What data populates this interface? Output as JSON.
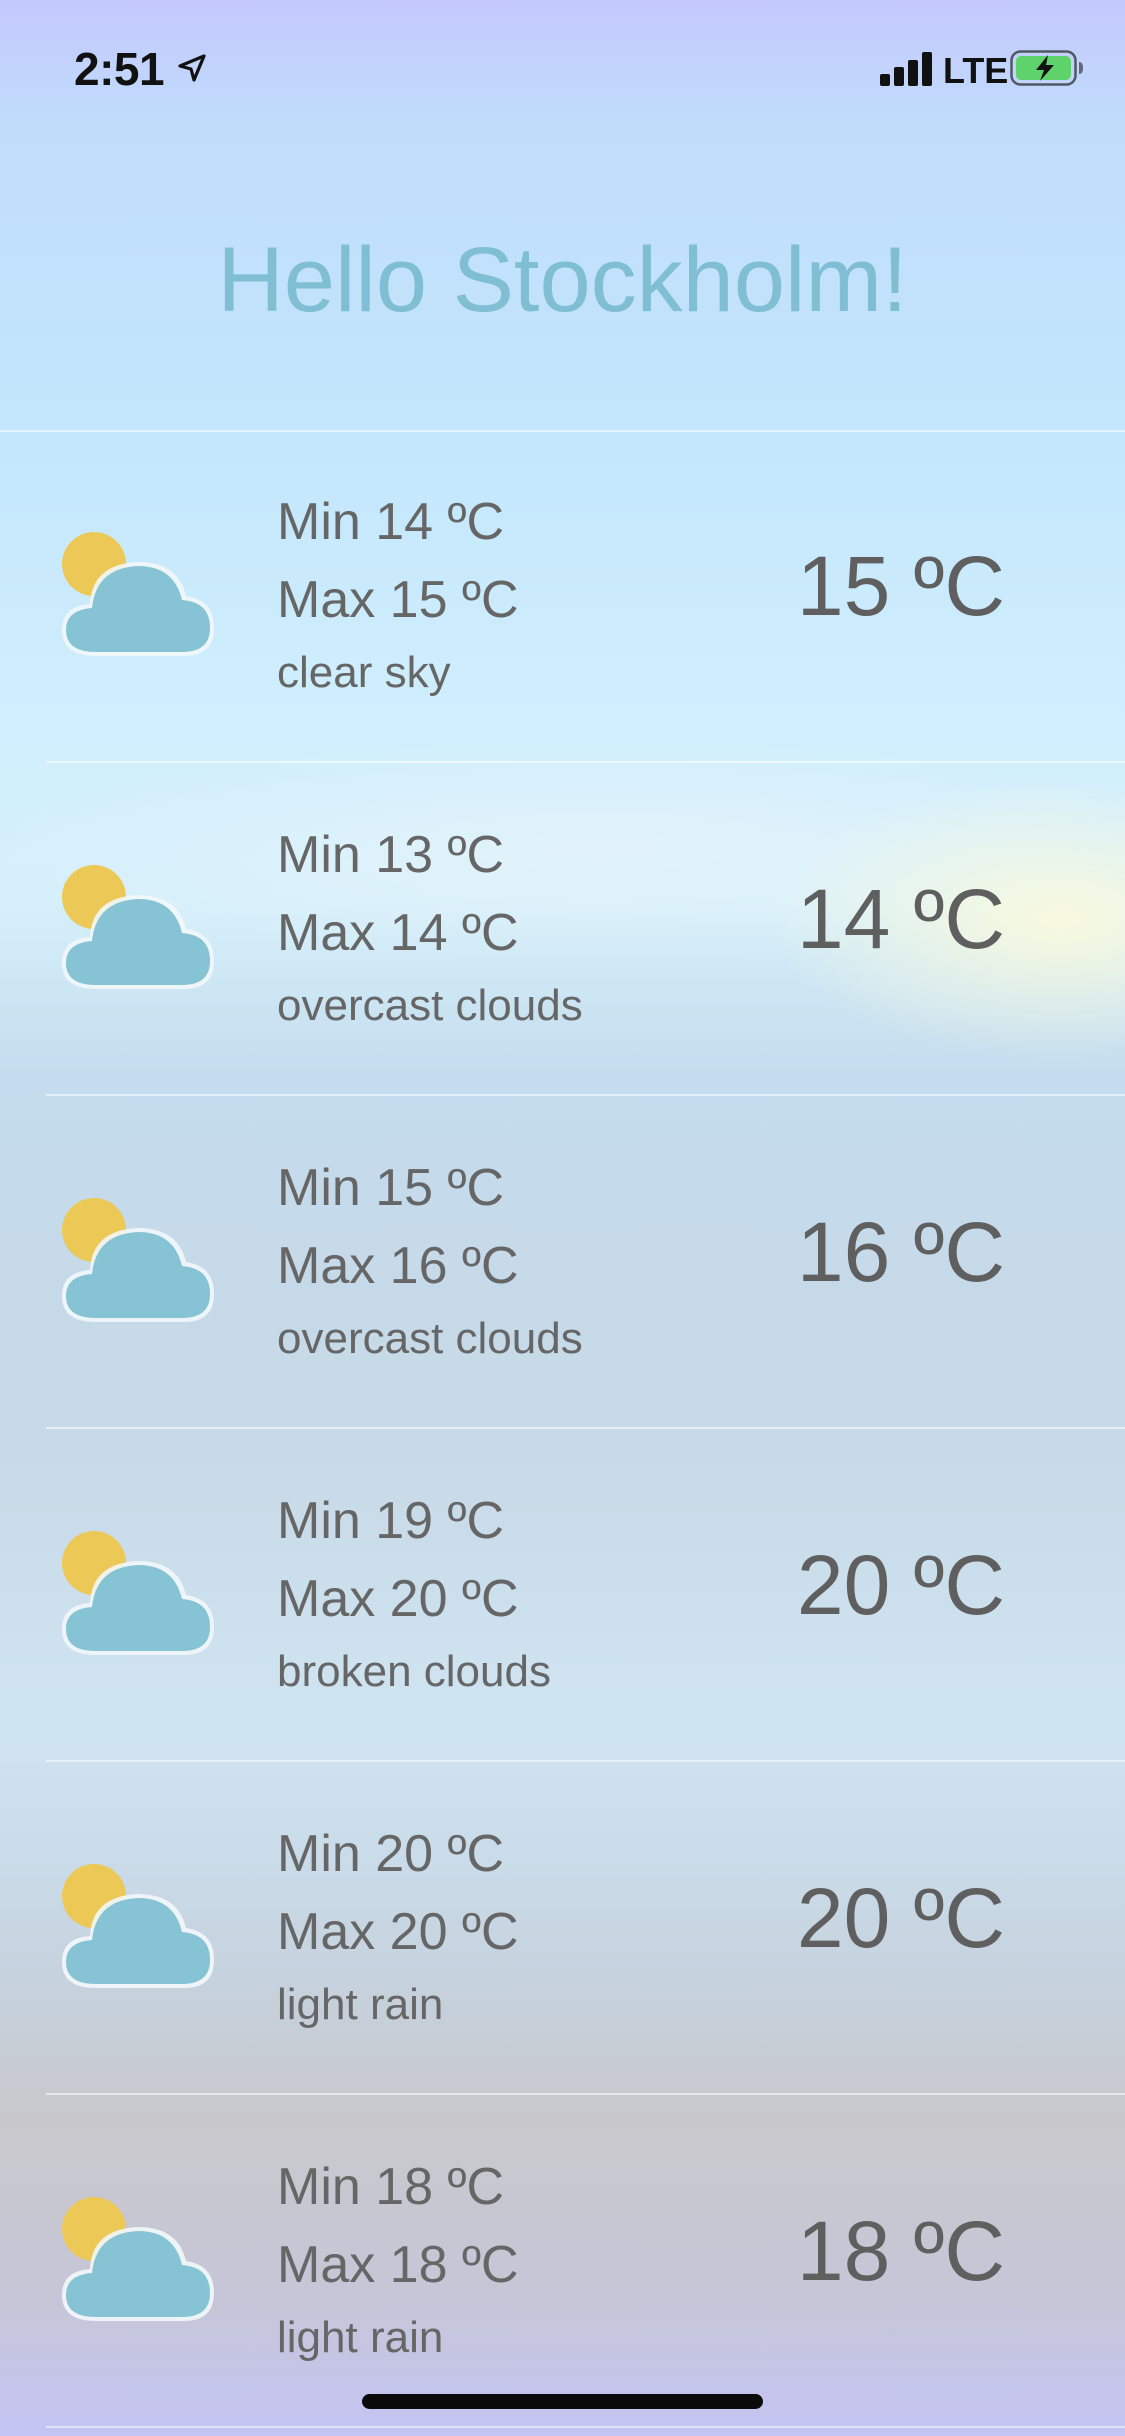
{
  "status_bar": {
    "time": "2:51",
    "network": "LTE",
    "icons": [
      "location-arrow-icon",
      "cellular-signal-icon",
      "battery-charging-icon"
    ],
    "battery_color": "#5fd36b"
  },
  "header": {
    "title": "Hello Stockholm!",
    "title_color": "#7fbed3"
  },
  "forecast": [
    {
      "min": "Min 14 ºC",
      "max": "Max 15 ºC",
      "description": "clear sky",
      "temp": "15 ºC",
      "icon": "partly-cloudy-icon"
    },
    {
      "min": "Min 13 ºC",
      "max": "Max 14 ºC",
      "description": "overcast clouds",
      "temp": "14 ºC",
      "icon": "partly-cloudy-icon"
    },
    {
      "min": "Min 15 ºC",
      "max": "Max 16 ºC",
      "description": "overcast clouds",
      "temp": "16 ºC",
      "icon": "partly-cloudy-icon"
    },
    {
      "min": "Min 19 ºC",
      "max": "Max 20 ºC",
      "description": "broken clouds",
      "temp": "20 ºC",
      "icon": "partly-cloudy-icon"
    },
    {
      "min": "Min 20 ºC",
      "max": "Max 20 ºC",
      "description": "light rain",
      "temp": "20 ºC",
      "icon": "partly-cloudy-icon"
    },
    {
      "min": "Min 18 ºC",
      "max": "Max 18 ºC",
      "description": "light rain",
      "temp": "18 ºC",
      "icon": "partly-cloudy-icon"
    }
  ],
  "colors": {
    "sun": "#ecc957",
    "cloud": "#86c3d4",
    "text": "#666666"
  }
}
